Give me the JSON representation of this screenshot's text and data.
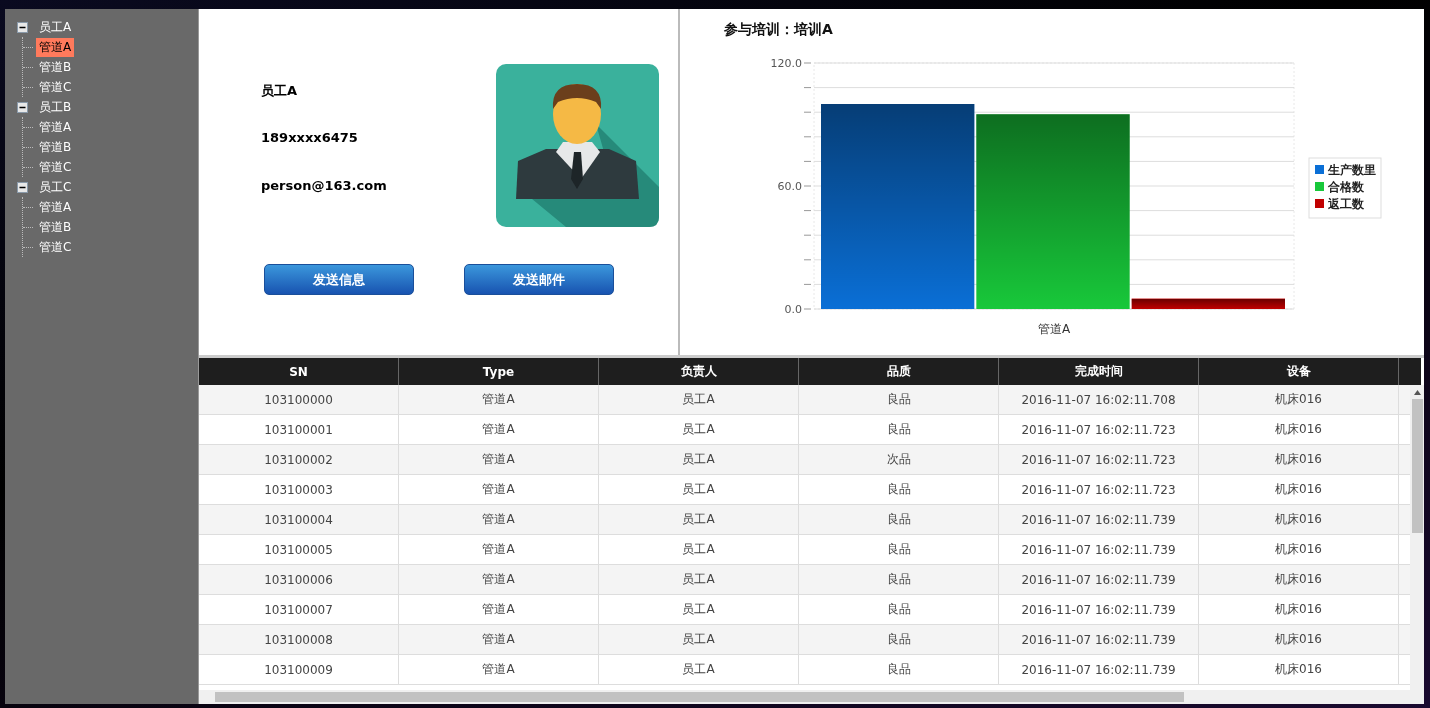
{
  "tree": [
    {
      "label": "员工A",
      "expanded": true,
      "children": [
        {
          "label": "管道A",
          "selected": true
        },
        {
          "label": "管道B",
          "selected": false
        },
        {
          "label": "管道C",
          "selected": false
        }
      ]
    },
    {
      "label": "员工B",
      "expanded": true,
      "children": [
        {
          "label": "管道A",
          "selected": false
        },
        {
          "label": "管道B",
          "selected": false
        },
        {
          "label": "管道C",
          "selected": false
        }
      ]
    },
    {
      "label": "员工C",
      "expanded": true,
      "children": [
        {
          "label": "管道A",
          "selected": false
        },
        {
          "label": "管道B",
          "selected": false
        },
        {
          "label": "管道C",
          "selected": false
        }
      ]
    }
  ],
  "profile": {
    "name": "员工A",
    "phone": "189xxxx6475",
    "email": "person@163.com",
    "buttons": [
      "发送信息",
      "发送邮件"
    ]
  },
  "chart": {
    "title": "参与培训：培训A",
    "chart_data": {
      "type": "bar",
      "categories": [
        "管道A"
      ],
      "series": [
        {
          "name": "生产数里",
          "color": "#0a6fd6",
          "values": [
            100
          ]
        },
        {
          "name": "合格数",
          "color": "#18c83a",
          "values": [
            95
          ]
        },
        {
          "name": "返工数",
          "color": "#c00000",
          "values": [
            5
          ]
        }
      ],
      "legend": true,
      "ylim": [
        0,
        120
      ],
      "yticks": [
        {
          "value": 0,
          "label": "0.0"
        },
        {
          "value": 60,
          "label": "60.0"
        },
        {
          "value": 120,
          "label": "120.0"
        }
      ]
    }
  },
  "table": {
    "columns": [
      "SN",
      "Type",
      "负责人",
      "品质",
      "完成时间",
      "设备"
    ],
    "rows": [
      [
        "103100000",
        "管道A",
        "员工A",
        "良品",
        "2016-11-07 16:02:11.708",
        "机床016"
      ],
      [
        "103100001",
        "管道A",
        "员工A",
        "良品",
        "2016-11-07 16:02:11.723",
        "机床016"
      ],
      [
        "103100002",
        "管道A",
        "员工A",
        "次品",
        "2016-11-07 16:02:11.723",
        "机床016"
      ],
      [
        "103100003",
        "管道A",
        "员工A",
        "良品",
        "2016-11-07 16:02:11.723",
        "机床016"
      ],
      [
        "103100004",
        "管道A",
        "员工A",
        "良品",
        "2016-11-07 16:02:11.739",
        "机床016"
      ],
      [
        "103100005",
        "管道A",
        "员工A",
        "良品",
        "2016-11-07 16:02:11.739",
        "机床016"
      ],
      [
        "103100006",
        "管道A",
        "员工A",
        "良品",
        "2016-11-07 16:02:11.739",
        "机床016"
      ],
      [
        "103100007",
        "管道A",
        "员工A",
        "良品",
        "2016-11-07 16:02:11.739",
        "机床016"
      ],
      [
        "103100008",
        "管道A",
        "员工A",
        "良品",
        "2016-11-07 16:02:11.739",
        "机床016"
      ],
      [
        "103100009",
        "管道A",
        "员工A",
        "良品",
        "2016-11-07 16:02:11.739",
        "机床016"
      ]
    ]
  }
}
